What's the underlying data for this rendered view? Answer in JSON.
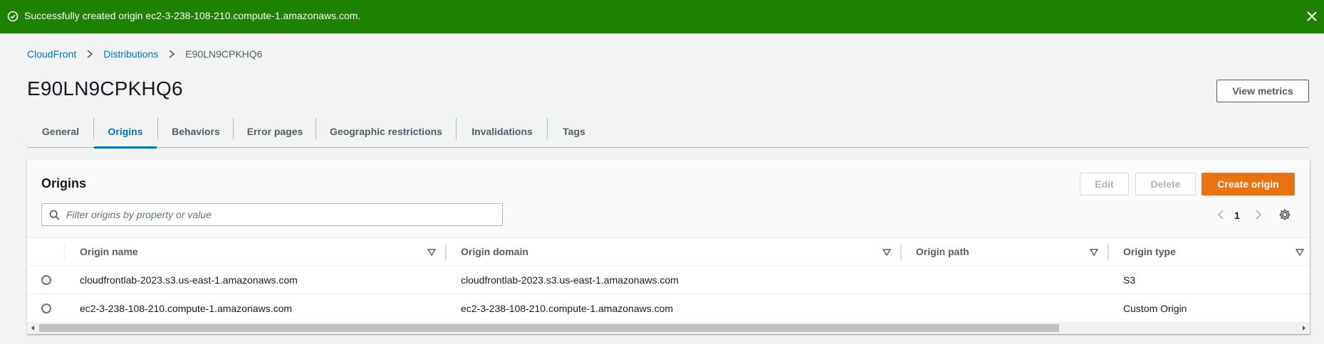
{
  "flash": {
    "message": "Successfully created origin ec2-3-238-108-210.compute-1.amazonaws.com.",
    "icon": "check-circle-icon",
    "close_icon": "close-icon",
    "color": "#1d8102"
  },
  "breadcrumb": {
    "items": [
      "CloudFront",
      "Distributions",
      "E90LN9CPKHQ6"
    ]
  },
  "page": {
    "title": "E90LN9CPKHQ6",
    "view_metrics": "View metrics"
  },
  "tabs": [
    {
      "label": "General"
    },
    {
      "label": "Origins",
      "active": true
    },
    {
      "label": "Behaviors"
    },
    {
      "label": "Error pages"
    },
    {
      "label": "Geographic restrictions"
    },
    {
      "label": "Invalidations"
    },
    {
      "label": "Tags"
    }
  ],
  "origins": {
    "title": "Origins",
    "edit": "Edit",
    "delete": "Delete",
    "create": "Create origin",
    "search_placeholder": "Filter origins by property or value",
    "page": "1",
    "columns": [
      "Origin name",
      "Origin domain",
      "Origin path",
      "Origin type"
    ],
    "rows": [
      {
        "name": "cloudfrontlab-2023.s3.us-east-1.amazonaws.com",
        "domain": "cloudfrontlab-2023.s3.us-east-1.amazonaws.com",
        "path": "",
        "type": "S3"
      },
      {
        "name": "ec2-3-238-108-210.compute-1.amazonaws.com",
        "domain": "ec2-3-238-108-210.compute-1.amazonaws.com",
        "path": "",
        "type": "Custom Origin"
      }
    ]
  },
  "colors": {
    "accent": "#0073bb",
    "primary_button": "#ec7211"
  }
}
